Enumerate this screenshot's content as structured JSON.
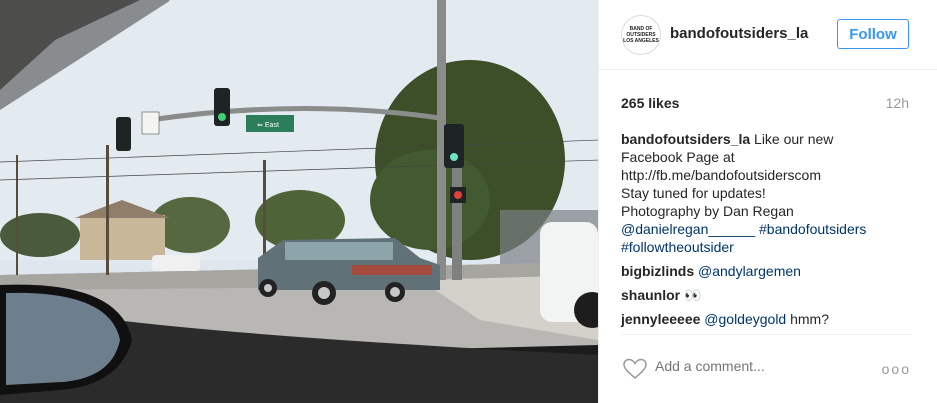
{
  "post": {
    "photo_icon": "street-scene-photo",
    "avatar_text": "BAND OF OUTSIDERS LOS ANGELES",
    "username": "bandofoutsiders_la",
    "follow_label": "Follow",
    "likes": "265 likes",
    "time": "12h",
    "caption": {
      "user": "bandofoutsiders_la",
      "lines": [
        "Like our new",
        "Facebook Page at",
        "http://fb.me/bandofoutsiderscom",
        "Stay tuned for updates!",
        "Photography by Dan Regan"
      ],
      "mention": "@danielregan______",
      "tags": [
        "#bandofoutsiders",
        "#followtheoutsider"
      ]
    },
    "comments": [
      {
        "user": "bigbizlinds",
        "text": "@andylargemen",
        "is_link": true
      },
      {
        "user": "shaunlor",
        "text": "👀",
        "is_link": false
      },
      {
        "user": "jennyleeeee",
        "text": "@goldeygold",
        "suffix": "hmm?",
        "is_link": true
      }
    ],
    "add_comment_placeholder": "Add a comment...",
    "more_label": "ooo",
    "sign_text": "⇐ East",
    "colors": {
      "accent": "#3897f0",
      "link": "#003569",
      "muted": "#999999"
    }
  }
}
